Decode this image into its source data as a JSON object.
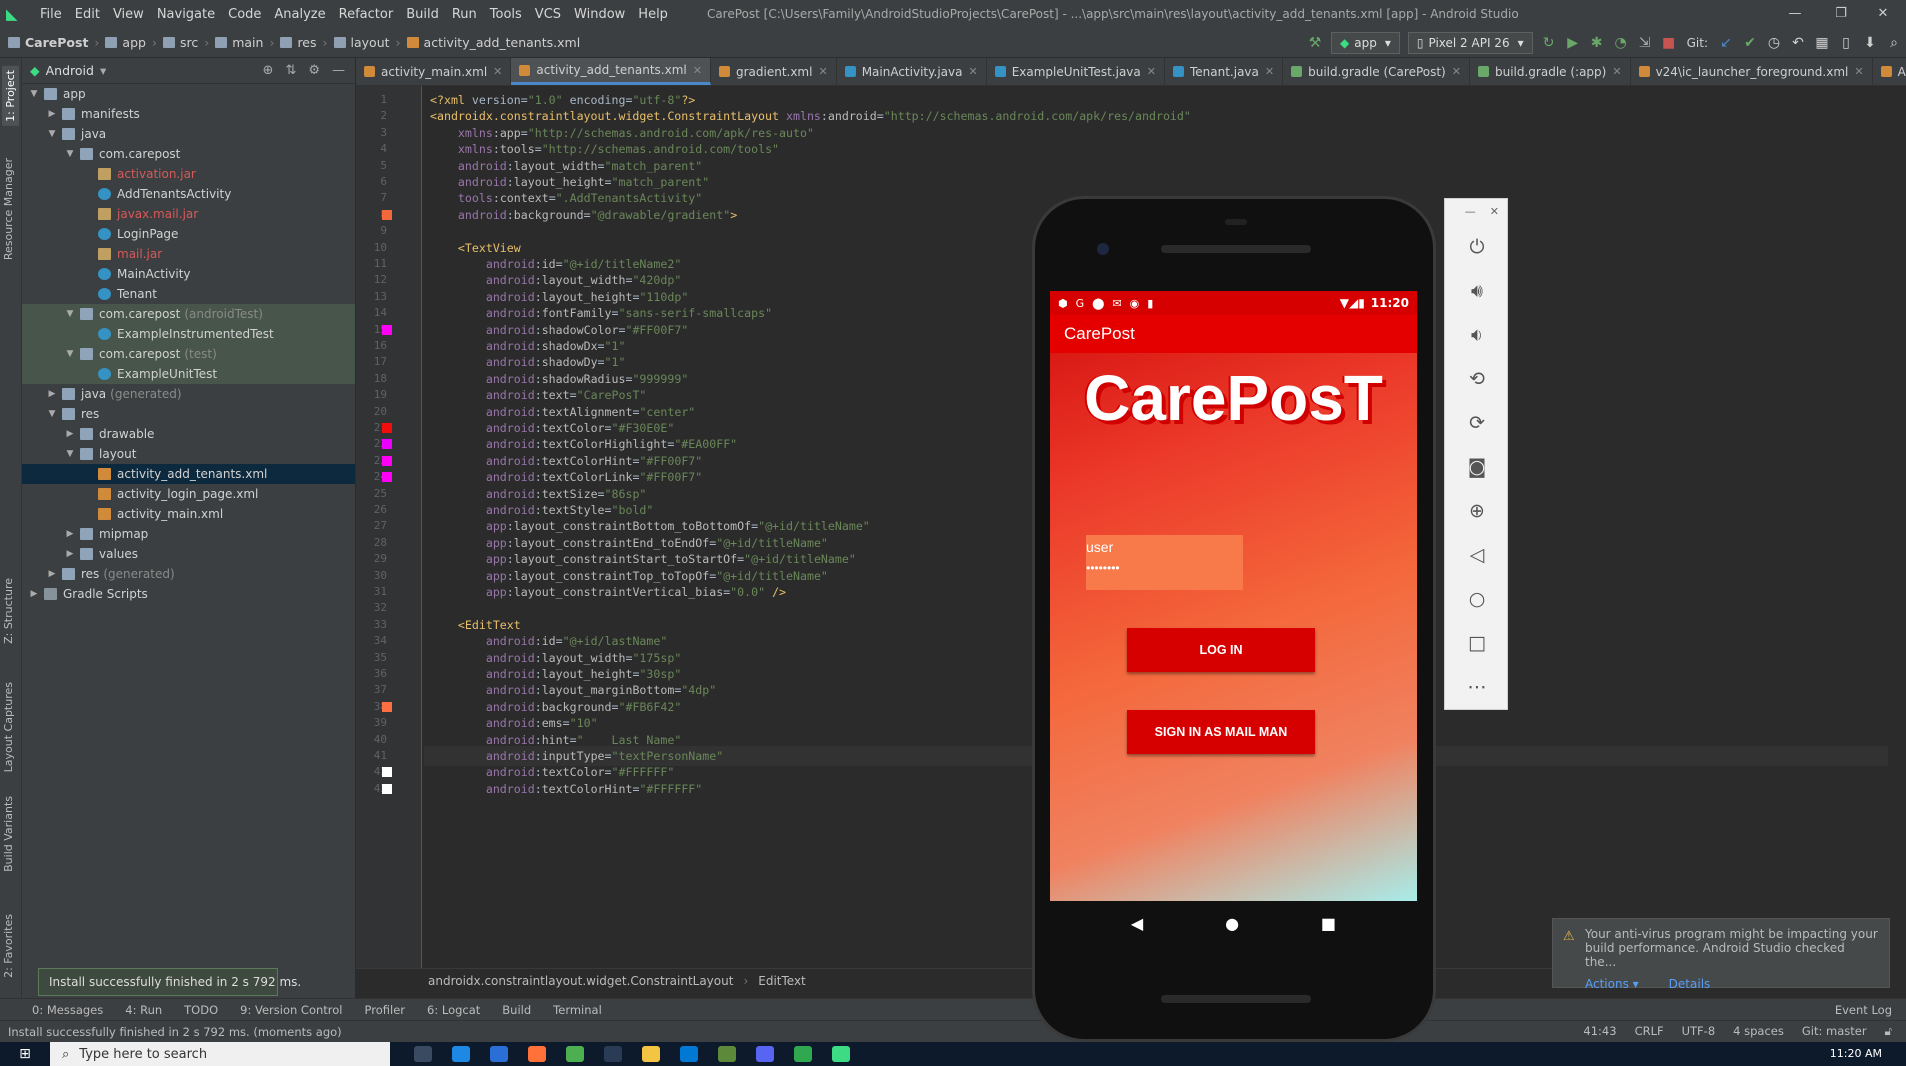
{
  "menu": {
    "items": [
      "File",
      "Edit",
      "View",
      "Navigate",
      "Code",
      "Analyze",
      "Refactor",
      "Build",
      "Run",
      "Tools",
      "VCS",
      "Window",
      "Help"
    ],
    "title": "CarePost [C:\\Users\\Family\\AndroidStudioProjects\\CarePost] - ...\\app\\src\\main\\res\\layout\\activity_add_tenants.xml [app] - Android Studio"
  },
  "breadcrumb": [
    "CarePost",
    "app",
    "src",
    "main",
    "res",
    "layout",
    "activity_add_tenants.xml"
  ],
  "toolbar": {
    "run_config": "app",
    "device": "Pixel 2 API 26",
    "git_label": "Git:"
  },
  "project": {
    "view_label": "Android",
    "tree": [
      {
        "label": "app",
        "indent": 0,
        "icon": "folder",
        "arrow": "▼"
      },
      {
        "label": "manifests",
        "indent": 1,
        "icon": "folder",
        "arrow": "▶"
      },
      {
        "label": "java",
        "indent": 1,
        "icon": "folder",
        "arrow": "▼"
      },
      {
        "label": "com.carepost",
        "indent": 2,
        "icon": "folder",
        "arrow": "▼"
      },
      {
        "label": "activation.jar",
        "indent": 3,
        "icon": "jar",
        "arrow": "",
        "style": "red"
      },
      {
        "label": "AddTenantsActivity",
        "indent": 3,
        "icon": "class",
        "arrow": ""
      },
      {
        "label": "javax.mail.jar",
        "indent": 3,
        "icon": "jar",
        "arrow": "",
        "style": "red"
      },
      {
        "label": "LoginPage",
        "indent": 3,
        "icon": "class",
        "arrow": ""
      },
      {
        "label": "mail.jar",
        "indent": 3,
        "icon": "jar",
        "arrow": "",
        "style": "red"
      },
      {
        "label": "MainActivity",
        "indent": 3,
        "icon": "class",
        "arrow": ""
      },
      {
        "label": "Tenant",
        "indent": 3,
        "icon": "class",
        "arrow": ""
      },
      {
        "label": "com.carepost",
        "indent": 2,
        "icon": "folder",
        "arrow": "▼",
        "style": "test",
        "suffix": "(androidTest)"
      },
      {
        "label": "ExampleInstrumentedTest",
        "indent": 3,
        "icon": "class",
        "arrow": "",
        "style": "test"
      },
      {
        "label": "com.carepost",
        "indent": 2,
        "icon": "folder",
        "arrow": "▼",
        "style": "test",
        "suffix": "(test)"
      },
      {
        "label": "ExampleUnitTest",
        "indent": 3,
        "icon": "class",
        "arrow": "",
        "style": "test"
      },
      {
        "label": "java",
        "indent": 1,
        "icon": "folder",
        "arrow": "▶",
        "suffix": "(generated)"
      },
      {
        "label": "res",
        "indent": 1,
        "icon": "folder",
        "arrow": "▼"
      },
      {
        "label": "drawable",
        "indent": 2,
        "icon": "folder",
        "arrow": "▶"
      },
      {
        "label": "layout",
        "indent": 2,
        "icon": "folder",
        "arrow": "▼"
      },
      {
        "label": "activity_add_tenants.xml",
        "indent": 3,
        "icon": "xml",
        "arrow": "",
        "style": "sel"
      },
      {
        "label": "activity_login_page.xml",
        "indent": 3,
        "icon": "xml",
        "arrow": ""
      },
      {
        "label": "activity_main.xml",
        "indent": 3,
        "icon": "xml",
        "arrow": ""
      },
      {
        "label": "mipmap",
        "indent": 2,
        "icon": "folder",
        "arrow": "▶"
      },
      {
        "label": "values",
        "indent": 2,
        "icon": "folder",
        "arrow": "▶"
      },
      {
        "label": "res",
        "indent": 1,
        "icon": "folder",
        "arrow": "▶",
        "suffix": "(generated)"
      },
      {
        "label": "Gradle Scripts",
        "indent": 0,
        "icon": "src",
        "arrow": "▶"
      }
    ]
  },
  "side_tabs": [
    "1: Project",
    "Resource Manager",
    "Z: Structure",
    "Layout Captures",
    "Build Variants",
    "2: Favorites"
  ],
  "tabs": [
    {
      "label": "activity_main.xml",
      "icon": "#d08a3a",
      "active": false
    },
    {
      "label": "activity_add_tenants.xml",
      "icon": "#d08a3a",
      "active": true
    },
    {
      "label": "gradient.xml",
      "icon": "#d08a3a",
      "active": false
    },
    {
      "label": "MainActivity.java",
      "icon": "#3592c4",
      "active": false
    },
    {
      "label": "ExampleUnitTest.java",
      "icon": "#3592c4",
      "active": false
    },
    {
      "label": "Tenant.java",
      "icon": "#3592c4",
      "active": false
    },
    {
      "label": "build.gradle (CarePost)",
      "icon": "#6aa86a",
      "active": false
    },
    {
      "label": "build.gradle (:app)",
      "icon": "#6aa86a",
      "active": false
    },
    {
      "label": "v24\\ic_launcher_foreground.xml",
      "icon": "#d08a3a",
      "active": false
    },
    {
      "label": "AndroidManifest.xml",
      "icon": "#d08a3a",
      "active": false
    }
  ],
  "code": {
    "lines": [
      "<?xml version=\"1.0\" encoding=\"utf-8\"?>",
      "<androidx.constraintlayout.widget.ConstraintLayout xmlns:android=\"http://schemas.android.com/apk/res/android\"",
      "    xmlns:app=\"http://schemas.android.com/apk/res-auto\"",
      "    xmlns:tools=\"http://schemas.android.com/tools\"",
      "    android:layout_width=\"match_parent\"",
      "    android:layout_height=\"match_parent\"",
      "    tools:context=\".AddTenantsActivity\"",
      "    android:background=\"@drawable/gradient\">",
      "",
      "    <TextView",
      "        android:id=\"@+id/titleName2\"",
      "        android:layout_width=\"420dp\"",
      "        android:layout_height=\"110dp\"",
      "        android:fontFamily=\"sans-serif-smallcaps\"",
      "        android:shadowColor=\"#FF00F7\"",
      "        android:shadowDx=\"1\"",
      "        android:shadowDy=\"1\"",
      "        android:shadowRadius=\"999999\"",
      "        android:text=\"CarePosT\"",
      "        android:textAlignment=\"center\"",
      "        android:textColor=\"#F30E0E\"",
      "        android:textColorHighlight=\"#EA00FF\"",
      "        android:textColorHint=\"#FF00F7\"",
      "        android:textColorLink=\"#FF00F7\"",
      "        android:textSize=\"86sp\"",
      "        android:textStyle=\"bold\"",
      "        app:layout_constraintBottom_toBottomOf=\"@+id/titleName\"",
      "        app:layout_constraintEnd_toEndOf=\"@+id/titleName\"",
      "        app:layout_constraintStart_toStartOf=\"@+id/titleName\"",
      "        app:layout_constraintTop_toTopOf=\"@+id/titleName\"",
      "        app:layout_constraintVertical_bias=\"0.0\" />",
      "",
      "    <EditText",
      "        android:id=\"@+id/lastName\"",
      "        android:layout_width=\"175sp\"",
      "        android:layout_height=\"30sp\"",
      "        android:layout_marginBottom=\"4dp\"",
      "        android:background=\"#FB6F42\"",
      "        android:ems=\"10\"",
      "        android:hint=\"    Last Name\"",
      "        android:inputType=\"textPersonName\"",
      "        android:textColor=\"#FFFFFF\"",
      "        android:textColorHint=\"#FFFFFF\""
    ],
    "current_line": 41,
    "breadcrumb": [
      "androidx.constraintlayout.widget.ConstraintLayout",
      "EditText"
    ]
  },
  "gutter_markers": [
    {
      "line": 8,
      "color": "#f4683c"
    },
    {
      "line": 15,
      "color": "#ff00f7"
    },
    {
      "line": 21,
      "color": "#f30e0e"
    },
    {
      "line": 22,
      "color": "#ea00ff"
    },
    {
      "line": 23,
      "color": "#ff00f7"
    },
    {
      "line": 24,
      "color": "#ff00f7"
    },
    {
      "line": 38,
      "color": "#fb6f42"
    },
    {
      "line": 42,
      "color": "#ffffff"
    },
    {
      "line": 43,
      "color": "#ffffff"
    }
  ],
  "emulator": {
    "time": "11:20",
    "app_title": "CarePost",
    "brand_big": "CarePosT",
    "user_value": "user",
    "password_mask": "••••••••",
    "login_label": "LOG IN",
    "mailman_label": "SIGN IN AS MAIL MAN"
  },
  "balloon": "Install successfully finished in 2 s 792 ms.",
  "notification": {
    "text": "Your anti-virus program might be impacting your build performance. Android Studio checked the...",
    "actions": "Actions ▾",
    "details": "Details"
  },
  "tool_windows": [
    "0: Messages",
    "4: Run",
    "TODO",
    "9: Version Control",
    "Profiler",
    "6: Logcat",
    "Build",
    "Terminal"
  ],
  "event_log": "Event Log",
  "status": {
    "message": "Install successfully finished in 2 s 792 ms. (moments ago)",
    "position": "41:43",
    "line_sep": "CRLF",
    "encoding": "UTF-8",
    "indent": "4 spaces",
    "git": "Git: master"
  },
  "taskbar": {
    "search_placeholder": "Type here to search",
    "time": "11:20 AM"
  }
}
